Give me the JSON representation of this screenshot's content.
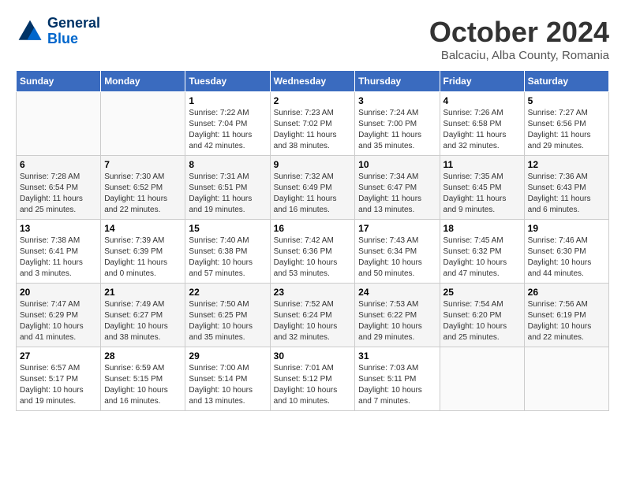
{
  "header": {
    "logo_line1": "General",
    "logo_line2": "Blue",
    "month": "October 2024",
    "location": "Balcaciu, Alba County, Romania"
  },
  "days_of_week": [
    "Sunday",
    "Monday",
    "Tuesday",
    "Wednesday",
    "Thursday",
    "Friday",
    "Saturday"
  ],
  "weeks": [
    [
      {
        "num": "",
        "detail": ""
      },
      {
        "num": "",
        "detail": ""
      },
      {
        "num": "1",
        "detail": "Sunrise: 7:22 AM\nSunset: 7:04 PM\nDaylight: 11 hours and 42 minutes."
      },
      {
        "num": "2",
        "detail": "Sunrise: 7:23 AM\nSunset: 7:02 PM\nDaylight: 11 hours and 38 minutes."
      },
      {
        "num": "3",
        "detail": "Sunrise: 7:24 AM\nSunset: 7:00 PM\nDaylight: 11 hours and 35 minutes."
      },
      {
        "num": "4",
        "detail": "Sunrise: 7:26 AM\nSunset: 6:58 PM\nDaylight: 11 hours and 32 minutes."
      },
      {
        "num": "5",
        "detail": "Sunrise: 7:27 AM\nSunset: 6:56 PM\nDaylight: 11 hours and 29 minutes."
      }
    ],
    [
      {
        "num": "6",
        "detail": "Sunrise: 7:28 AM\nSunset: 6:54 PM\nDaylight: 11 hours and 25 minutes."
      },
      {
        "num": "7",
        "detail": "Sunrise: 7:30 AM\nSunset: 6:52 PM\nDaylight: 11 hours and 22 minutes."
      },
      {
        "num": "8",
        "detail": "Sunrise: 7:31 AM\nSunset: 6:51 PM\nDaylight: 11 hours and 19 minutes."
      },
      {
        "num": "9",
        "detail": "Sunrise: 7:32 AM\nSunset: 6:49 PM\nDaylight: 11 hours and 16 minutes."
      },
      {
        "num": "10",
        "detail": "Sunrise: 7:34 AM\nSunset: 6:47 PM\nDaylight: 11 hours and 13 minutes."
      },
      {
        "num": "11",
        "detail": "Sunrise: 7:35 AM\nSunset: 6:45 PM\nDaylight: 11 hours and 9 minutes."
      },
      {
        "num": "12",
        "detail": "Sunrise: 7:36 AM\nSunset: 6:43 PM\nDaylight: 11 hours and 6 minutes."
      }
    ],
    [
      {
        "num": "13",
        "detail": "Sunrise: 7:38 AM\nSunset: 6:41 PM\nDaylight: 11 hours and 3 minutes."
      },
      {
        "num": "14",
        "detail": "Sunrise: 7:39 AM\nSunset: 6:39 PM\nDaylight: 11 hours and 0 minutes."
      },
      {
        "num": "15",
        "detail": "Sunrise: 7:40 AM\nSunset: 6:38 PM\nDaylight: 10 hours and 57 minutes."
      },
      {
        "num": "16",
        "detail": "Sunrise: 7:42 AM\nSunset: 6:36 PM\nDaylight: 10 hours and 53 minutes."
      },
      {
        "num": "17",
        "detail": "Sunrise: 7:43 AM\nSunset: 6:34 PM\nDaylight: 10 hours and 50 minutes."
      },
      {
        "num": "18",
        "detail": "Sunrise: 7:45 AM\nSunset: 6:32 PM\nDaylight: 10 hours and 47 minutes."
      },
      {
        "num": "19",
        "detail": "Sunrise: 7:46 AM\nSunset: 6:30 PM\nDaylight: 10 hours and 44 minutes."
      }
    ],
    [
      {
        "num": "20",
        "detail": "Sunrise: 7:47 AM\nSunset: 6:29 PM\nDaylight: 10 hours and 41 minutes."
      },
      {
        "num": "21",
        "detail": "Sunrise: 7:49 AM\nSunset: 6:27 PM\nDaylight: 10 hours and 38 minutes."
      },
      {
        "num": "22",
        "detail": "Sunrise: 7:50 AM\nSunset: 6:25 PM\nDaylight: 10 hours and 35 minutes."
      },
      {
        "num": "23",
        "detail": "Sunrise: 7:52 AM\nSunset: 6:24 PM\nDaylight: 10 hours and 32 minutes."
      },
      {
        "num": "24",
        "detail": "Sunrise: 7:53 AM\nSunset: 6:22 PM\nDaylight: 10 hours and 29 minutes."
      },
      {
        "num": "25",
        "detail": "Sunrise: 7:54 AM\nSunset: 6:20 PM\nDaylight: 10 hours and 25 minutes."
      },
      {
        "num": "26",
        "detail": "Sunrise: 7:56 AM\nSunset: 6:19 PM\nDaylight: 10 hours and 22 minutes."
      }
    ],
    [
      {
        "num": "27",
        "detail": "Sunrise: 6:57 AM\nSunset: 5:17 PM\nDaylight: 10 hours and 19 minutes."
      },
      {
        "num": "28",
        "detail": "Sunrise: 6:59 AM\nSunset: 5:15 PM\nDaylight: 10 hours and 16 minutes."
      },
      {
        "num": "29",
        "detail": "Sunrise: 7:00 AM\nSunset: 5:14 PM\nDaylight: 10 hours and 13 minutes."
      },
      {
        "num": "30",
        "detail": "Sunrise: 7:01 AM\nSunset: 5:12 PM\nDaylight: 10 hours and 10 minutes."
      },
      {
        "num": "31",
        "detail": "Sunrise: 7:03 AM\nSunset: 5:11 PM\nDaylight: 10 hours and 7 minutes."
      },
      {
        "num": "",
        "detail": ""
      },
      {
        "num": "",
        "detail": ""
      }
    ]
  ]
}
